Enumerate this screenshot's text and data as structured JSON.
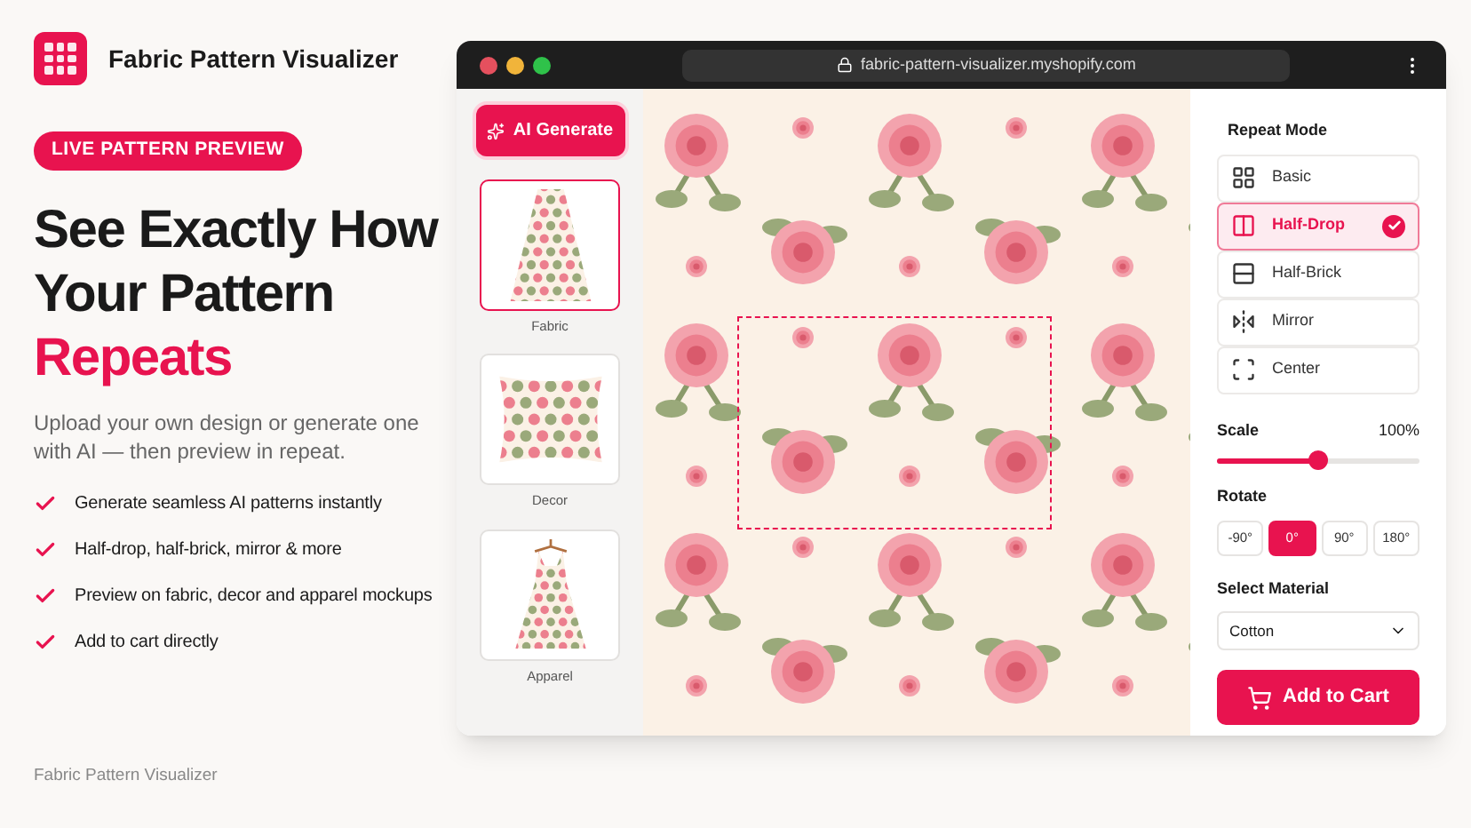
{
  "brand": {
    "name": "Fabric Pattern Visualizer"
  },
  "badge": "LIVE PATTERN PREVIEW",
  "headline": {
    "line_1": "See Exactly How",
    "line_2": "Your Pattern",
    "accent": "Repeats"
  },
  "subtitle": "Upload your own design or generate one with AI — then preview in repeat.",
  "features": [
    "Generate seamless AI patterns instantly",
    "Half-drop, half-brick, mirror & more",
    "Preview on fabric, decor and apparel mockups",
    "Add to cart directly"
  ],
  "footer": "Fabric Pattern Visualizer",
  "browser": {
    "url": "fabric-pattern-visualizer.myshopify.com"
  },
  "ai_button": "AI Generate",
  "mockups": [
    {
      "label": "Fabric",
      "kind": "fabric",
      "selected": true
    },
    {
      "label": "Decor",
      "kind": "pillow",
      "selected": false
    },
    {
      "label": "Apparel",
      "kind": "dress",
      "selected": false
    }
  ],
  "repeat_mode": {
    "title": "Repeat Mode",
    "options": [
      {
        "label": "Basic",
        "kind": "basic",
        "selected": false
      },
      {
        "label": "Half-Drop",
        "kind": "half-drop",
        "selected": true
      },
      {
        "label": "Half-Brick",
        "kind": "half-brick",
        "selected": false
      },
      {
        "label": "Mirror",
        "kind": "mirror",
        "selected": false
      },
      {
        "label": "Center",
        "kind": "center",
        "selected": false
      }
    ]
  },
  "scale": {
    "label": "Scale",
    "reading": "100%",
    "level": 0.5
  },
  "rotate": {
    "label": "Rotate",
    "options": [
      {
        "label": "-90°",
        "selected": false
      },
      {
        "label": "0°",
        "selected": true
      },
      {
        "label": "90°",
        "selected": false
      },
      {
        "label": "180°",
        "selected": false
      }
    ]
  },
  "material": {
    "label": "Select Material",
    "value": "Cotton"
  },
  "cart_button": "Add to Cart"
}
